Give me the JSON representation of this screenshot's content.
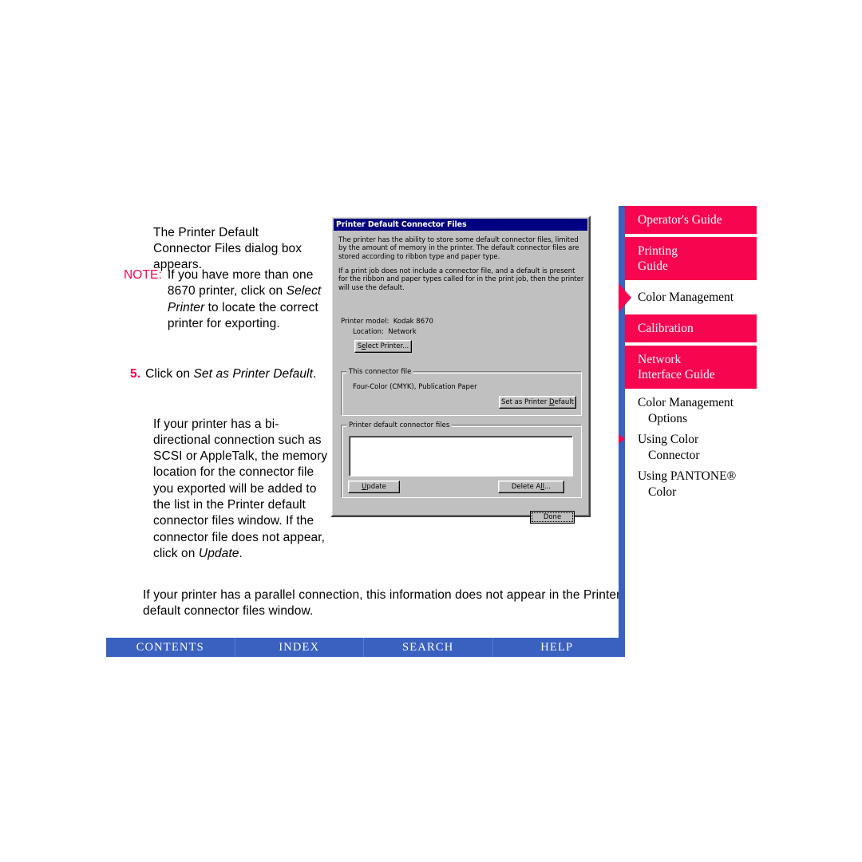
{
  "content": {
    "intro_paragraph": "The Printer Default Connector Files dialog box appears.",
    "note": {
      "label": "NOTE:",
      "text_1": "If you have more than one 8670 printer, click on ",
      "italic_1": "Select Printer",
      "text_2": " to locate the correct printer for exporting."
    },
    "step": {
      "number": "5.",
      "text_1": "Click on ",
      "italic_1": "Set as Printer Default",
      "text_2": "."
    },
    "continuation_paragraph": {
      "text_1": "If your printer has a bi-directional connection such as SCSI or AppleTalk, the memory location for the connector file you exported will be added to the list in the Printer default connector files window. If the connector file does not appear, click on ",
      "italic_1": "Update",
      "text_2": "."
    },
    "final_paragraph": "If your printer has a parallel connection, this information does not appear in the Printer default connector files window."
  },
  "dialog": {
    "title": "Printer Default Connector Files",
    "paragraph_1": "The printer has the ability to store some default connector files, limited by the amount of memory in the printer.  The default connector files are stored according to ribbon type and paper type.",
    "paragraph_2": "If a print job does not include a connector file, and a default is present for the ribbon and paper types called for in the print job, then the printer will use the default.",
    "printer_model_label": "Printer model:",
    "printer_model_value": "Kodak 8670",
    "location_label": "Location:",
    "location_value": "Network",
    "buttons": {
      "select_printer_pre": "S",
      "select_printer_accel": "e",
      "select_printer_post": "lect Printer...",
      "set_as_printer_default_pre": "Set as Printer ",
      "set_as_printer_default_accel": "D",
      "set_as_printer_default_post": "efault",
      "update_accel": "U",
      "update_post": "pdate",
      "delete_all_pre": "Delete A",
      "delete_all_accel": "ll",
      "delete_all_post": "...",
      "done": "Done"
    },
    "group_connector_file": {
      "legend": "This connector file",
      "value": "Four-Color (CMYK), Publication Paper"
    },
    "group_default_files": {
      "legend": "Printer default connector files",
      "items": []
    }
  },
  "nav": {
    "items": [
      {
        "label_line_1": "Operator's Guide",
        "label_line_2": "",
        "active": false
      },
      {
        "label_line_1": "Printing",
        "label_line_2": "Guide",
        "active": false
      },
      {
        "label_line_1": "Color Management",
        "label_line_2": "",
        "active": true
      },
      {
        "label_line_1": "Calibration",
        "label_line_2": "",
        "active": false
      },
      {
        "label_line_1": "Network",
        "label_line_2": "Interface Guide",
        "active": false
      }
    ],
    "subitems": [
      {
        "label_line_1": "Color Management",
        "label_line_2": "Options",
        "active": false
      },
      {
        "label_line_1": "Using Color",
        "label_line_2": "Connector",
        "active": true
      },
      {
        "label_line_1": "Using PANTONE®",
        "label_line_2": "Color",
        "active": false
      }
    ]
  },
  "bottom_bar": {
    "items": [
      "CONTENTS",
      "INDEX",
      "SEARCH",
      "HELP"
    ]
  },
  "colors": {
    "accent_pink": "#f7054f",
    "accent_blue": "#3a60c0",
    "dialog_title": "#000080",
    "dialog_face": "#c0c0c0"
  }
}
